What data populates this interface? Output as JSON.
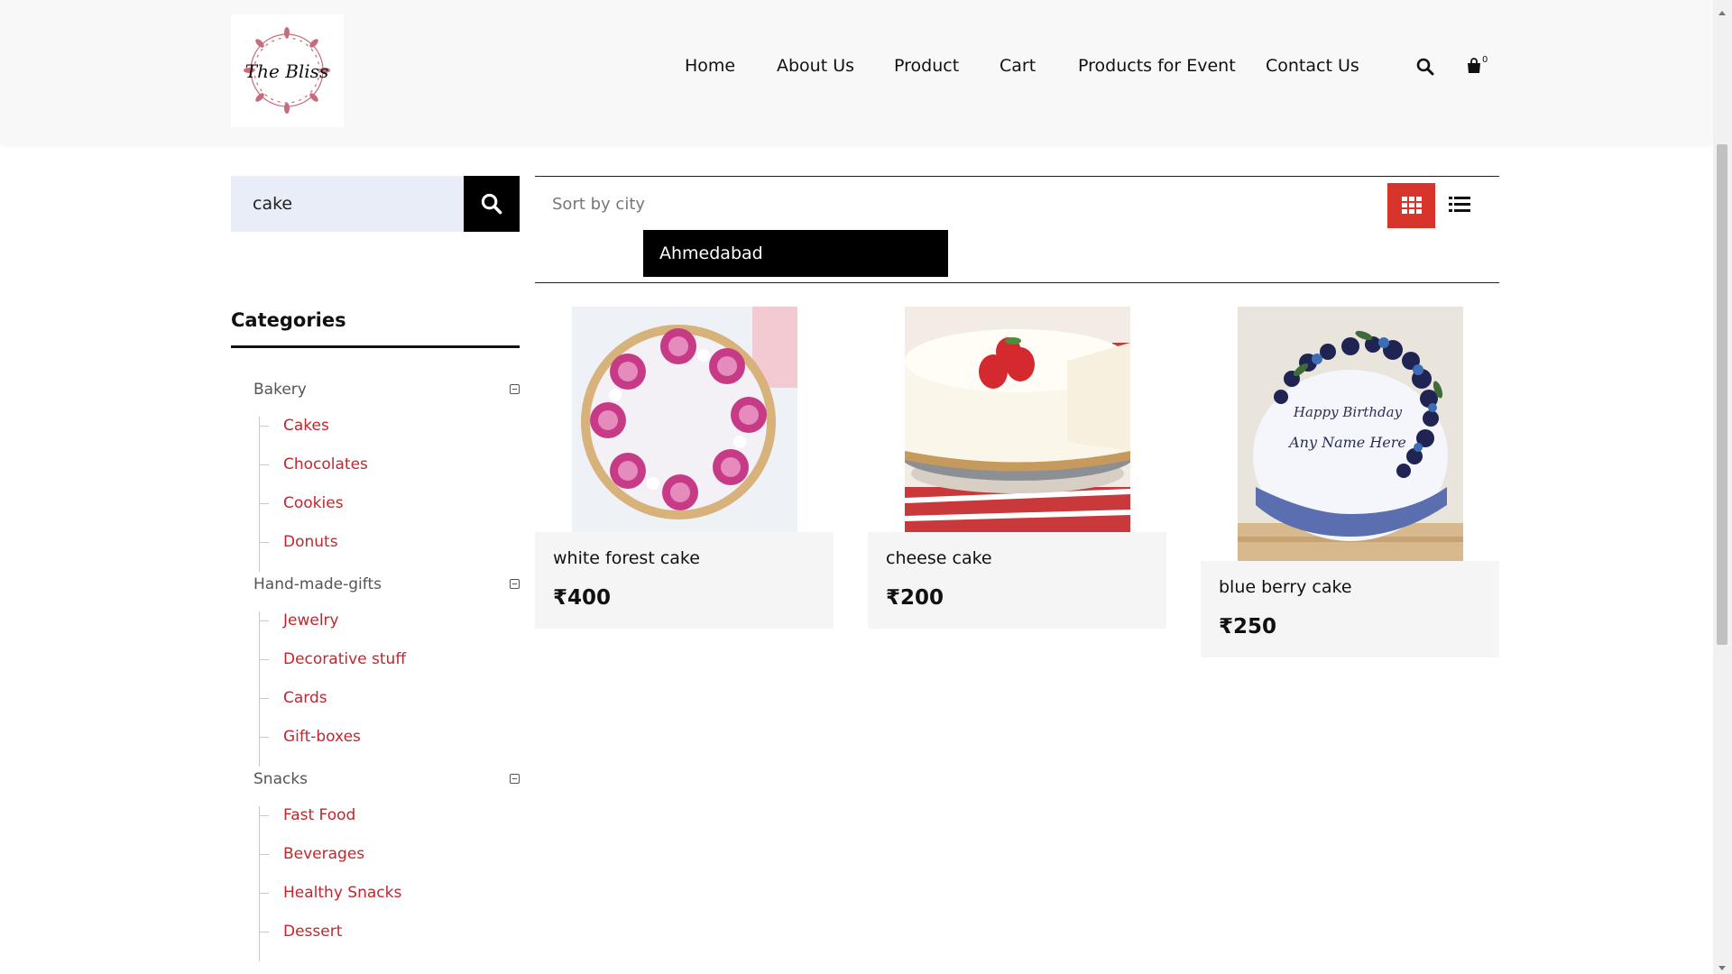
{
  "brand": {
    "logo_text": "The Bliss",
    "accent": "#d7342c",
    "category_link_color": "#c0272d"
  },
  "nav": {
    "items": [
      {
        "label": "Home"
      },
      {
        "label": "About Us"
      },
      {
        "label": "Product"
      },
      {
        "label": "Cart"
      },
      {
        "label": "Products for Event"
      },
      {
        "label": "Contact Us"
      }
    ],
    "search_icon": "search-icon",
    "cart_icon": "shopping-bag-icon",
    "cart_count": "0"
  },
  "sidebar": {
    "search": {
      "value": "cake",
      "button_icon": "search-icon"
    },
    "categories_title": "Categories",
    "groups": [
      {
        "name": "Bakery",
        "items": [
          "Cakes",
          "Chocolates",
          "Cookies",
          "Donuts"
        ]
      },
      {
        "name": "Hand-made-gifts",
        "items": [
          "Jewelry",
          "Decorative stuff",
          "Cards",
          "Gift-boxes"
        ]
      },
      {
        "name": "Snacks",
        "items": [
          "Fast Food",
          "Beverages",
          "Healthy Snacks",
          "Dessert"
        ]
      }
    ]
  },
  "toolbar": {
    "sort_label": "Sort by city",
    "selected_city": "Ahmedabad",
    "view_grid_icon": "grid-view-icon",
    "view_list_icon": "list-view-icon"
  },
  "products": [
    {
      "name": "white forest cake",
      "price": "₹400"
    },
    {
      "name": "cheese cake",
      "price": "₹200"
    },
    {
      "name": "blue berry cake",
      "price": "₹250",
      "image_text_1": "Happy Birthday",
      "image_text_2": "Any Name Here"
    }
  ]
}
